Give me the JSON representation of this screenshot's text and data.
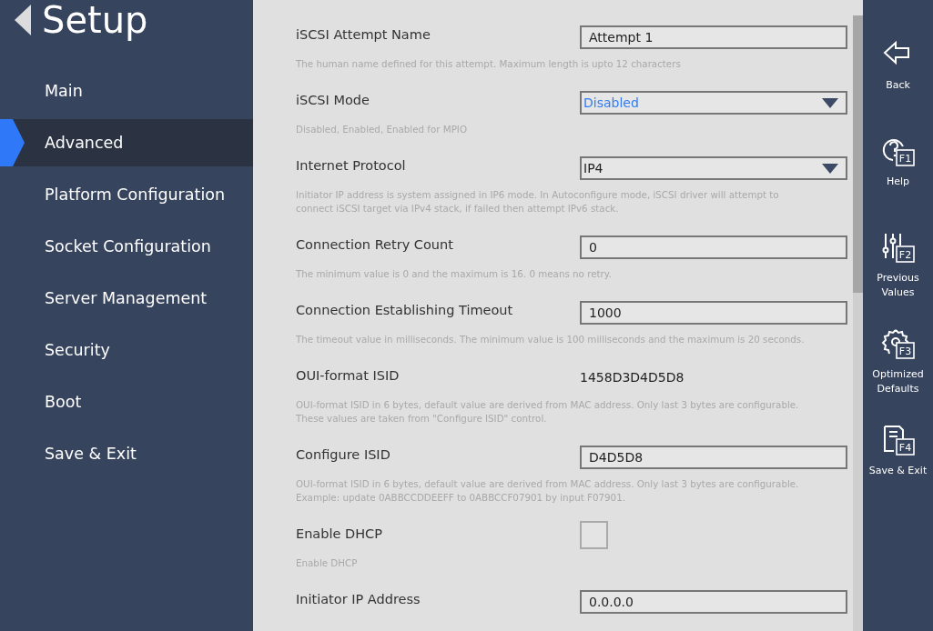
{
  "header": {
    "title": "Setup"
  },
  "menu": [
    {
      "label": "Main",
      "selected": false
    },
    {
      "label": "Advanced",
      "selected": true
    },
    {
      "label": "Platform Configuration",
      "selected": false
    },
    {
      "label": "Socket Configuration",
      "selected": false
    },
    {
      "label": "Server Management",
      "selected": false
    },
    {
      "label": "Security",
      "selected": false
    },
    {
      "label": "Boot",
      "selected": false
    },
    {
      "label": "Save & Exit",
      "selected": false
    }
  ],
  "settings": [
    {
      "kind": "text",
      "label": "iSCSI Attempt Name",
      "value": "Attempt 1",
      "description": [
        "The human name defined for this attempt. Maximum length is upto 12 characters"
      ]
    },
    {
      "kind": "select",
      "label": "iSCSI Mode",
      "value": "Disabled",
      "focused": true,
      "description": [
        "Disabled, Enabled, Enabled for MPIO"
      ]
    },
    {
      "kind": "select",
      "label": "Internet Protocol",
      "value": "IP4",
      "description": [
        "Initiator IP address is system assigned in IP6 mode. In Autoconfigure mode, iSCSI driver will attempt to",
        "connect iSCSI target via IPv4 stack, if failed then attempt IPv6 stack."
      ]
    },
    {
      "kind": "text",
      "label": "Connection Retry Count",
      "value": "0",
      "description": [
        "The minimum value is 0 and the maximum is 16. 0 means no retry."
      ]
    },
    {
      "kind": "text",
      "label": "Connection Establishing Timeout",
      "value": "1000",
      "description": [
        "The timeout value in milliseconds. The minimum value is 100 milliseconds and the maximum is 20 seconds."
      ]
    },
    {
      "kind": "static",
      "label": "OUI-format ISID",
      "value": "1458D3D4D5D8",
      "description": [
        "OUI-format ISID in 6 bytes, default value are derived from MAC address. Only last 3 bytes are configurable.",
        "These values are taken from \"Configure ISID\" control."
      ]
    },
    {
      "kind": "text",
      "label": "Configure ISID",
      "value": "D4D5D8",
      "description": [
        "OUI-format ISID in 6 bytes, default value are derived from MAC address. Only last 3 bytes are configurable.",
        "Example: update 0ABBCCDDEEFF to 0ABBCCF07901 by input F07901."
      ]
    },
    {
      "kind": "checkbox",
      "label": "Enable DHCP",
      "checked": false,
      "description": [
        "Enable DHCP"
      ]
    },
    {
      "kind": "text",
      "label": "Initiator IP Address",
      "value": "0.0.0.0"
    }
  ],
  "actions": [
    {
      "kind": "back",
      "label": "Back"
    },
    {
      "kind": "help",
      "key": "F1",
      "label": "Help"
    },
    {
      "kind": "previous",
      "key": "F2",
      "label": "Previous Values"
    },
    {
      "kind": "optimized",
      "key": "F3",
      "label": "Optimized Defaults"
    },
    {
      "kind": "save",
      "key": "F4",
      "label": "Save & Exit"
    }
  ]
}
